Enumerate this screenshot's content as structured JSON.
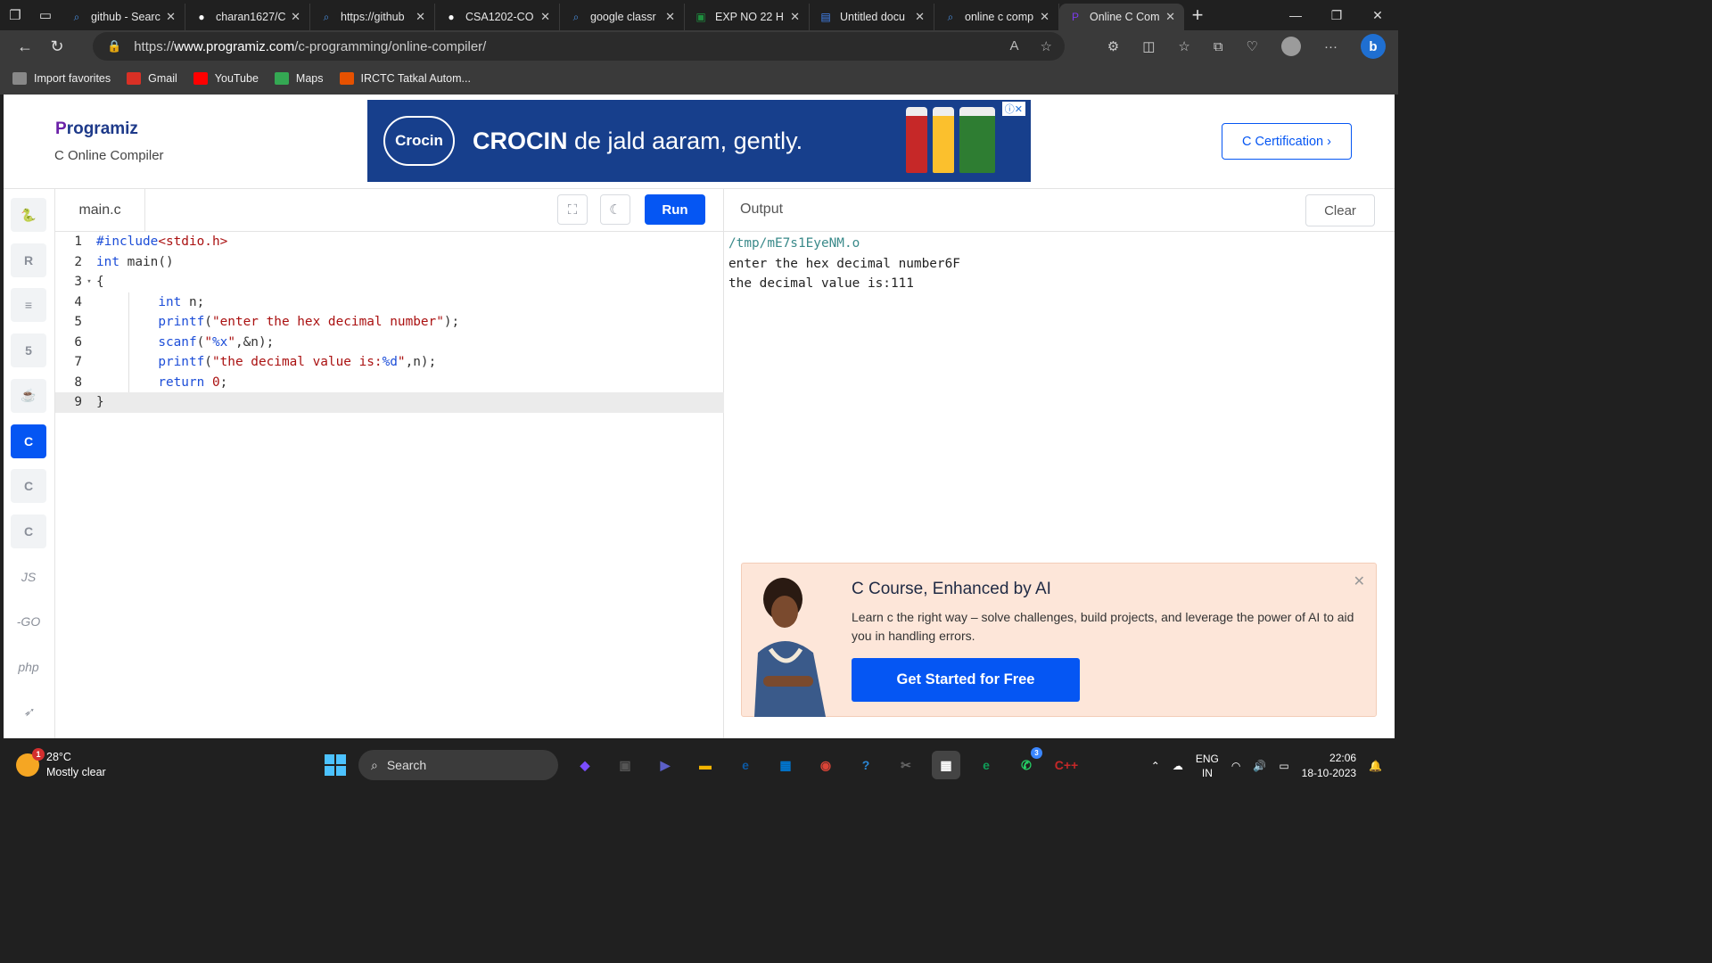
{
  "browser": {
    "tabs": [
      {
        "title": "github - Search",
        "icon": "search-icon",
        "color": "#4a90e2"
      },
      {
        "title": "charan1627/C",
        "icon": "github-icon",
        "color": "#ffffff"
      },
      {
        "title": "https://github",
        "icon": "search-icon",
        "color": "#4a90e2"
      },
      {
        "title": "CSA1202-CO",
        "icon": "github-icon",
        "color": "#ffffff"
      },
      {
        "title": "google classr",
        "icon": "search-icon",
        "color": "#4a90e2"
      },
      {
        "title": "EXP NO 22 H",
        "icon": "classroom-icon",
        "color": "#1e8e3e"
      },
      {
        "title": "Untitled docu",
        "icon": "docs-icon",
        "color": "#4285f4"
      },
      {
        "title": "online c comp",
        "icon": "search-icon",
        "color": "#4a90e2"
      },
      {
        "title": "Online C Com",
        "icon": "programiz-icon",
        "color": "#7c3aed"
      }
    ],
    "url_prefix": "https://",
    "url_host": "www.programiz.com",
    "url_path": "/c-programming/online-compiler/",
    "favorites": [
      {
        "label": "Import favorites",
        "color": "#888888"
      },
      {
        "label": "Gmail",
        "color": "#d93025"
      },
      {
        "label": "YouTube",
        "color": "#ff0000"
      },
      {
        "label": "Maps",
        "color": "#34a853"
      },
      {
        "label": "IRCTC Tatkal Autom...",
        "color": "#e65100"
      }
    ]
  },
  "site": {
    "logo_first": "P",
    "logo_rest": "rogramiz",
    "subtitle": "C Online Compiler",
    "certification_label": "C Certification ›",
    "ad": {
      "brand": "Crocin",
      "headline_bold": "CROCIN",
      "headline_rest": " de jald aaram, gently."
    }
  },
  "languages": [
    {
      "name": "python",
      "glyph": "🐍"
    },
    {
      "name": "r",
      "glyph": "R"
    },
    {
      "name": "sql",
      "glyph": "≡"
    },
    {
      "name": "html",
      "glyph": "5"
    },
    {
      "name": "java",
      "glyph": "☕"
    },
    {
      "name": "c",
      "glyph": "C"
    },
    {
      "name": "cpp",
      "glyph": "C"
    },
    {
      "name": "csharp",
      "glyph": "C"
    },
    {
      "name": "js",
      "glyph": "JS"
    },
    {
      "name": "go",
      "glyph": "-GO"
    },
    {
      "name": "php",
      "glyph": "php"
    },
    {
      "name": "swift",
      "glyph": "➶"
    }
  ],
  "editor": {
    "filename": "main.c",
    "run_label": "Run",
    "lines": [
      [
        {
          "t": "#include",
          "c": "kw"
        },
        {
          "t": "<stdio.h>",
          "c": "str"
        }
      ],
      [
        {
          "t": "int",
          "c": "kw"
        },
        {
          "t": " main()",
          "c": ""
        }
      ],
      [
        {
          "t": "{",
          "c": ""
        }
      ],
      [
        {
          "t": "        ",
          "c": ""
        },
        {
          "t": "int",
          "c": "kw"
        },
        {
          "t": " n;",
          "c": ""
        }
      ],
      [
        {
          "t": "        ",
          "c": ""
        },
        {
          "t": "printf",
          "c": "kw"
        },
        {
          "t": "(",
          "c": ""
        },
        {
          "t": "\"enter the hex decimal number\"",
          "c": "str"
        },
        {
          "t": ");",
          "c": ""
        }
      ],
      [
        {
          "t": "        ",
          "c": ""
        },
        {
          "t": "scanf",
          "c": "kw"
        },
        {
          "t": "(",
          "c": ""
        },
        {
          "t": "\"",
          "c": "str"
        },
        {
          "t": "%x",
          "c": "fmt"
        },
        {
          "t": "\"",
          "c": "str"
        },
        {
          "t": ",&n);",
          "c": ""
        }
      ],
      [
        {
          "t": "        ",
          "c": ""
        },
        {
          "t": "printf",
          "c": "kw"
        },
        {
          "t": "(",
          "c": ""
        },
        {
          "t": "\"the decimal value is:",
          "c": "str"
        },
        {
          "t": "%d",
          "c": "fmt"
        },
        {
          "t": "\"",
          "c": "str"
        },
        {
          "t": ",n);",
          "c": ""
        }
      ],
      [
        {
          "t": "        ",
          "c": ""
        },
        {
          "t": "return",
          "c": "kw"
        },
        {
          "t": " ",
          "c": ""
        },
        {
          "t": "0",
          "c": "str"
        },
        {
          "t": ";",
          "c": ""
        }
      ],
      [
        {
          "t": "}",
          "c": ""
        }
      ]
    ]
  },
  "output": {
    "title": "Output",
    "clear_label": "Clear",
    "lines": [
      "/tmp/mE7s1EyeNM.o",
      "enter the hex decimal number6F",
      "the decimal value is:111"
    ]
  },
  "promo": {
    "title": "C Course, Enhanced by AI",
    "description": "Learn c the right way – solve challenges, build projects, and leverage the power of AI to aid you in handling errors.",
    "button_label": "Get Started for Free"
  },
  "taskbar": {
    "weather_temp": "28°C",
    "weather_desc": "Mostly clear",
    "weather_badge": "1",
    "search_label": "Search",
    "language": "ENG",
    "region": "IN",
    "time": "22:06",
    "date": "18-10-2023",
    "apps": [
      {
        "name": "copilot-app-icon",
        "color": "#7b4dff",
        "glyph": "◆"
      },
      {
        "name": "task-view-icon",
        "color": "#555555",
        "glyph": "▣"
      },
      {
        "name": "teams-icon",
        "color": "#5b5fc7",
        "glyph": "▶"
      },
      {
        "name": "file-explorer-icon",
        "color": "#f4b400",
        "glyph": "▬"
      },
      {
        "name": "edge-icon",
        "color": "#0c59a4",
        "glyph": "e"
      },
      {
        "name": "store-icon",
        "color": "#0078d4",
        "glyph": "▦"
      },
      {
        "name": "chrome-icon",
        "color": "#db4437",
        "glyph": "◉"
      },
      {
        "name": "help-icon",
        "color": "#2b88d8",
        "glyph": "?"
      },
      {
        "name": "snipping-icon",
        "color": "#666666",
        "glyph": "✂"
      },
      {
        "name": "ms-store-icon",
        "color": "#ffffff",
        "glyph": "▦"
      },
      {
        "name": "edge-active-icon",
        "color": "#0f9d58",
        "glyph": "e"
      },
      {
        "name": "whatsapp-icon",
        "color": "#25d366",
        "glyph": "✆",
        "badge": "3"
      },
      {
        "name": "devcpp-icon",
        "color": "#c62828",
        "glyph": "C++"
      }
    ]
  }
}
